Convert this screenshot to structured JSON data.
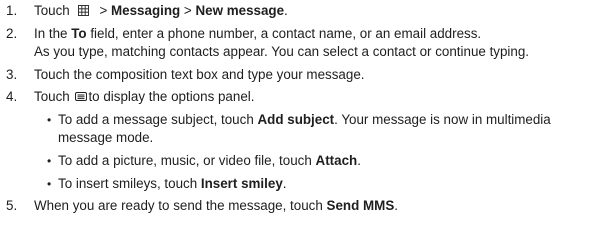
{
  "steps": [
    {
      "number": "1.",
      "pre": "Touch",
      "icon": "grid-icon",
      "mid": " > ",
      "bold1": "Messaging",
      "sep": " > ",
      "bold2": "New message",
      "post": "."
    },
    {
      "number": "2.",
      "pre": "In  the ",
      "bold1": "To",
      "post": " field, enter a phone number, a contact name, or an email address.",
      "cont": "As you type, matching contacts appear. You can select a contact or continue typing."
    },
    {
      "number": "3.",
      "text": "Touch the composition text box and type your message."
    },
    {
      "number": "4.",
      "pre": "Touch ",
      "icon": "menu-icon",
      "post": "to display the options panel."
    },
    {
      "number": "5.",
      "pre": "When you are ready to send the message, touch ",
      "bold1": "Send MMS",
      "post": "."
    }
  ],
  "bullets": [
    {
      "pre": "To add a message subject, touch ",
      "bold": "Add subject",
      "post": ". Your message is now in multimedia",
      "cont": "message mode."
    },
    {
      "pre": "To add a picture, music, or video file, touch ",
      "bold": "Attach",
      "post": "."
    },
    {
      "pre": "To insert smileys, touch ",
      "bold": "Insert smiley",
      "post": "."
    }
  ],
  "bullet_glyph": "•"
}
